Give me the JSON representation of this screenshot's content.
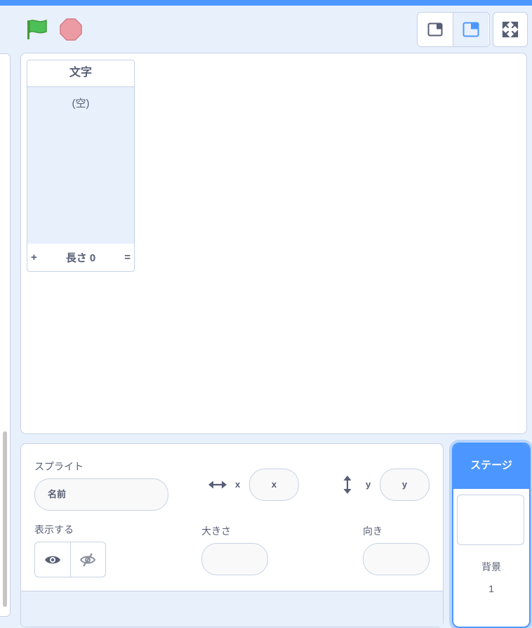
{
  "colors": {
    "accent": "#4c97ff",
    "flag_green": "#4cbf56",
    "stop_red": "#ec9ba4",
    "panel_bg": "#e8f0fc",
    "border": "#c6d2e6"
  },
  "controls": {
    "green_flag_icon": "green-flag-icon",
    "stop_icon": "stop-icon"
  },
  "layout_modes": {
    "small_stage_icon": "small-stage-icon",
    "normal_stage_icon": "normal-stage-icon",
    "fullscreen_icon": "fullscreen-icon"
  },
  "list_monitor": {
    "title": "文字",
    "empty_text": "(空)",
    "add": "+",
    "length_label": "長さ 0",
    "resize": "="
  },
  "sprite_info": {
    "sprite_label": "スプライト",
    "name_placeholder": "名前",
    "x_label": "x",
    "x_placeholder": "x",
    "y_label": "y",
    "y_placeholder": "y",
    "show_label": "表示する",
    "size_label": "大きさ",
    "direction_label": "向き"
  },
  "stage_selector": {
    "title": "ステージ",
    "backdrops_label": "背景",
    "backdrops_count": "1"
  }
}
